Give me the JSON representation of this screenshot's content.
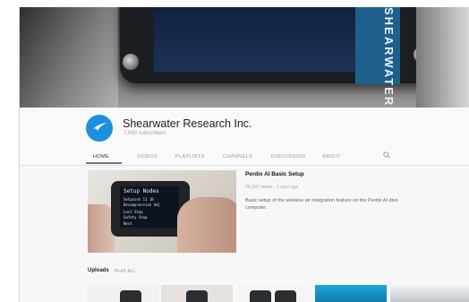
{
  "banner": {
    "brand_text": "SHEARWATER"
  },
  "channel": {
    "name": "Shearwater Research Inc.",
    "subscribers": "7,680 subscribers"
  },
  "tabs": [
    {
      "label": "HOME"
    },
    {
      "label": "VIDEOS"
    },
    {
      "label": "PLAYLISTS"
    },
    {
      "label": "CHANNELS"
    },
    {
      "label": "DISCUSSION"
    },
    {
      "label": "ABOUT"
    }
  ],
  "featured": {
    "title": "Perdix AI Basic Setup",
    "meta": "24,297 views · 1 year ago",
    "description": "Basic setup of the wireless air integration feature on the Perdix AI dive computer.",
    "screen_lines": [
      "Setup Nodes",
      "Setpoint 11 1B",
      "Decompression Adj",
      "Last Stop",
      "Safety Stop",
      "Next"
    ]
  },
  "uploads": {
    "title": "Uploads",
    "play_all": "PLAY ALL"
  },
  "icons": {
    "search": "search-icon",
    "avatar": "shearwater-logo-icon"
  },
  "colors": {
    "accent": "#1d8fe0"
  }
}
